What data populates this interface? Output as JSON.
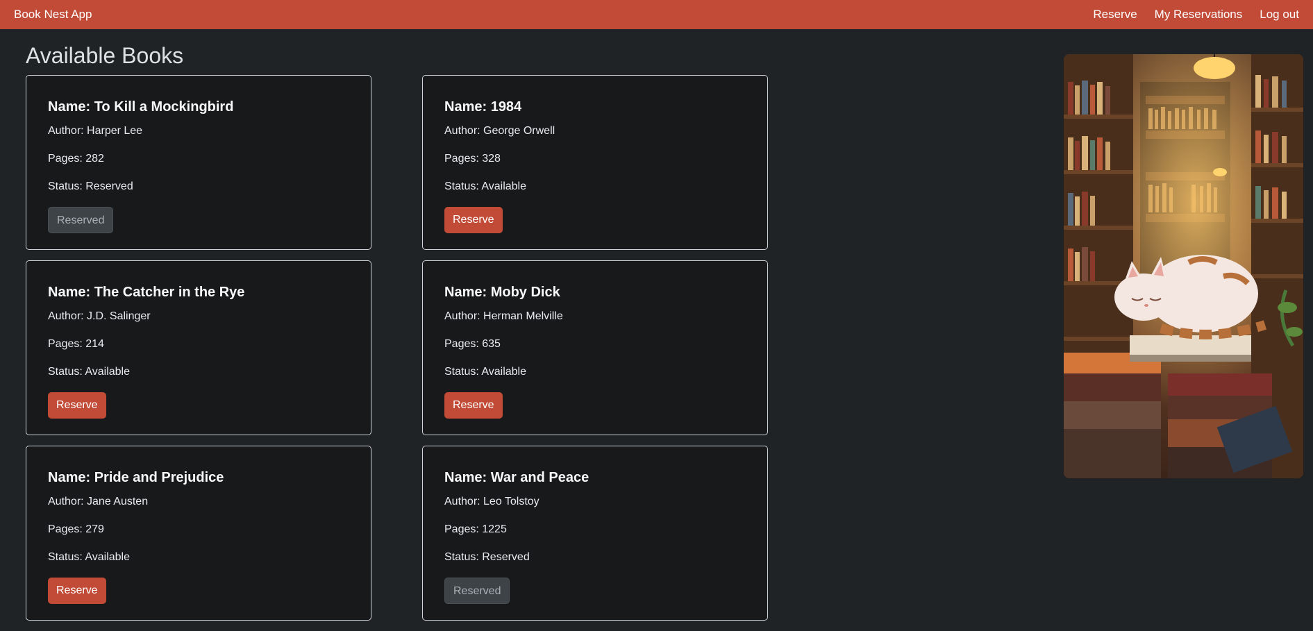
{
  "navbar": {
    "brand": "Book Nest App",
    "links": [
      "Reserve",
      "My Reservations",
      "Log out"
    ]
  },
  "page_title": "Available Books",
  "books": [
    {
      "name": "Name: To Kill a Mockingbird",
      "author": "Author: Harper Lee",
      "pages": "Pages: 282",
      "status": "Status: Reserved",
      "button": "Reserved",
      "reserved": true
    },
    {
      "name": "Name: 1984",
      "author": "Author: George Orwell",
      "pages": "Pages: 328",
      "status": "Status: Available",
      "button": "Reserve",
      "reserved": false
    },
    {
      "name": "Name: The Catcher in the Rye",
      "author": "Author: J.D. Salinger",
      "pages": "Pages: 214",
      "status": "Status: Available",
      "button": "Reserve",
      "reserved": false
    },
    {
      "name": "Name: Moby Dick",
      "author": "Author: Herman Melville",
      "pages": "Pages: 635",
      "status": "Status: Available",
      "button": "Reserve",
      "reserved": false
    },
    {
      "name": "Name: Pride and Prejudice",
      "author": "Author: Jane Austen",
      "pages": "Pages: 279",
      "status": "Status: Available",
      "button": "Reserve",
      "reserved": false
    },
    {
      "name": "Name: War and Peace",
      "author": "Author: Leo Tolstoy",
      "pages": "Pages: 1225",
      "status": "Status: Reserved",
      "button": "Reserved",
      "reserved": true
    }
  ],
  "colors": {
    "accent": "#c24b37",
    "background": "#1f2326",
    "card_background": "#17191b",
    "disabled_button": "#3e4347"
  },
  "side_image": {
    "icon": "bookstore-cat-illustration"
  }
}
